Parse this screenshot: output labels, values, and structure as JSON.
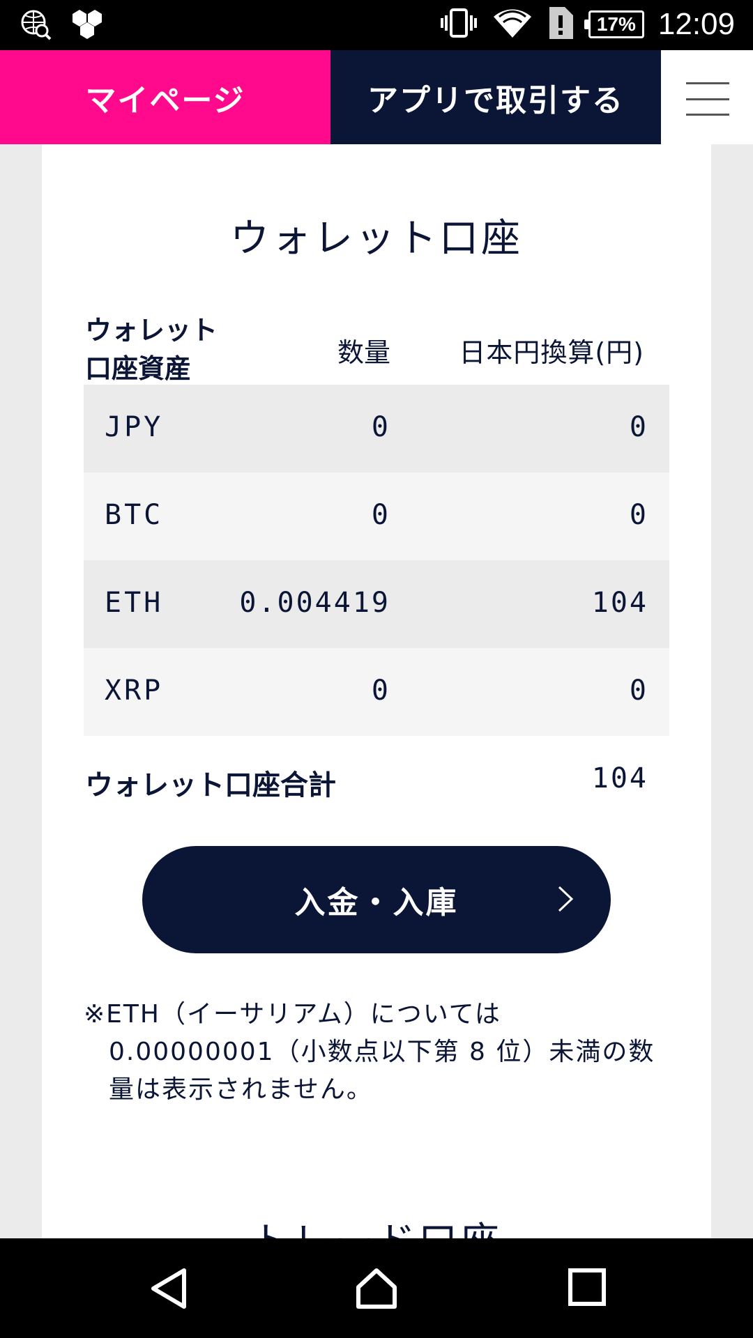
{
  "status_bar": {
    "time": "12:09",
    "battery": "17%",
    "icons": [
      "globe-search-icon",
      "hexagon-icon",
      "vibrate-icon",
      "wifi-icon",
      "alert-sim-icon",
      "battery-icon"
    ]
  },
  "header": {
    "mypage_label": "マイページ",
    "app_trade_label": "アプリで取引する",
    "menu_icon": "hamburger-menu-icon"
  },
  "wallet": {
    "title": "ウォレット口座",
    "columns": {
      "asset": "ウォレット\n口座資産",
      "asset_line1": "ウォレット",
      "asset_line2": "口座資産",
      "quantity": "数量",
      "jpy": "日本円換算(円)"
    },
    "rows": [
      {
        "asset": "JPY",
        "quantity": "0",
        "jpy": "0"
      },
      {
        "asset": "BTC",
        "quantity": "0",
        "jpy": "0"
      },
      {
        "asset": "ETH",
        "quantity": "0.004419",
        "jpy": "104"
      },
      {
        "asset": "XRP",
        "quantity": "0",
        "jpy": "0"
      }
    ],
    "total_label": "ウォレット口座合計",
    "total_value": "104",
    "deposit_button": "入金・入庫",
    "note_line1": "※ETH（イーサリアム）については",
    "note_line2": "0.00000001（小数点以下第 8 位）未満の数",
    "note_line3": "量は表示されません。"
  },
  "next_section_title": "トレード口座",
  "nav_bar": {
    "icons": [
      "back-icon",
      "home-icon",
      "recents-icon"
    ]
  }
}
